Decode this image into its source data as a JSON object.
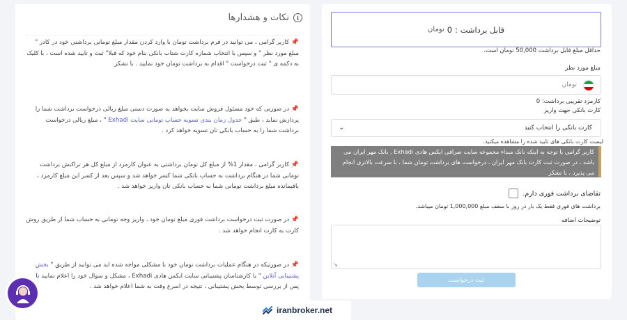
{
  "form": {
    "balance": {
      "label": "قابل برداشت :",
      "value": "0",
      "unit": "تومان"
    },
    "min_note": "حداقل مبلغ قابل برداشت 50,000 تومان است.",
    "amount_label": "مبلغ مورد نظر",
    "amount_placeholder": "تومان",
    "fee_label": "کارمزد تقریبی برداشت: 0",
    "card_label": "کارت بانکی جهت واریز",
    "card_select_value": "کارت بانکی را انتخاب کنید",
    "card_list_note": "لیست کارت بانکی های تایید شده را مشاهده میکنید.",
    "alert_text": "کاربر گرامی با توجه به اینکه بانک مبداء مجموعه سایت صرافی ایکس هادی Exhadi , بانک مهر ایران می باشد ، در صورت ثبت کارت بانک مهر ایران ، درخواست های برداشت تومان شما ، با سرعت بالاتری انجام می پذیرد ، با تشکر",
    "instant_label": "تقاضای برداشت فوری دارم.",
    "instant_limit_note": "برداشت های فوری فقط یک بار در روز با سقف مبلغ 1,000,000 تومان میباشد.",
    "extra_desc_label": "توضیحات اضافه",
    "submit_label": "ثبت درخواست"
  },
  "notes": {
    "title": "نکات و هشدارها",
    "items": [
      {
        "text": "کاربر گرامی ، می توانید در فرم برداشت تومان با وارد کردن مقدار مبلغ تومانی برداشتی خود در کادر \" مبلغ مورد نظر \" و سپس با انتخاب شماره کارت شتاب بانکی بنام خود که قبلا\" ثبت و تایید شده است ، با کلیک به دکمه ی \" ثبت درخواست \" اقدام به برداشت تومان خود نمایید . با تشکر"
      },
      {
        "pre": "در صورتی که خود مسئول فروش سایت بخواهد به صورت دستی مبلغ ریالی درخواست برداشت شما را پردازش نماید ، طبق \"",
        "link": "جدول زمان بندی تسویه حساب تومانی سایت Exhadi",
        "post": "\" ، مبلغ ریالی درخواست برداشت شما را به حساب بانکی تان تسویه خواهد کرد ."
      },
      {
        "text": "کاربر گرامی ، مقدار 1% از مبلغ کل تومان برداشتی به عنوان کارمزد از مبلغ کل هر تراکنش برداشت تومانی شما در هنگام برداشت به حساب بانکی شما کسر خواهد شد و سپس بعد از کسر این مبلغ کارمزد ، باقیمانده مبلغ برداشت تومانی شما به حساب بانکی تان واریز خواهد شد ."
      },
      {
        "text": "در صورت ثبت درخواست برداشت فوری مبلغ تومان خود ، واریز وجه تومانی به حساب شما از طریق روش کارت به کارت انجام خواهد شد ."
      },
      {
        "pre": "در صورتیکه در هنگام عملیات برداشت تومان خود با مشکلی مواجه شده اید می توانید از طریق \"",
        "link": "بخش پشتیبانی آنلاین",
        "post": "\" با کارشناسان پشتیبانی سایت ایکس هادی Exhadi ، مشکل و سوال خود را اعلام نمایید تا پس از بررسی توسط بخش پشتیبانی ، نتیجه در اسرع وقت به شما اعلام خواهد شد ."
      }
    ]
  },
  "watermark": {
    "text": "iranbroker.net"
  },
  "colors": {
    "accent": "#7b7fd8",
    "submit": "#a9d3ee",
    "alert_bg": "#7f7f7f",
    "link": "#5b5fd6",
    "avatar": "#5b2fb0"
  },
  "icons": {
    "info": "info-icon",
    "pin": "pushpin-icon",
    "flag": "iran-flag-icon",
    "chevron": "chevron-down-icon",
    "support": "support-agent-icon",
    "brand": "iranbroker-logo-icon"
  }
}
